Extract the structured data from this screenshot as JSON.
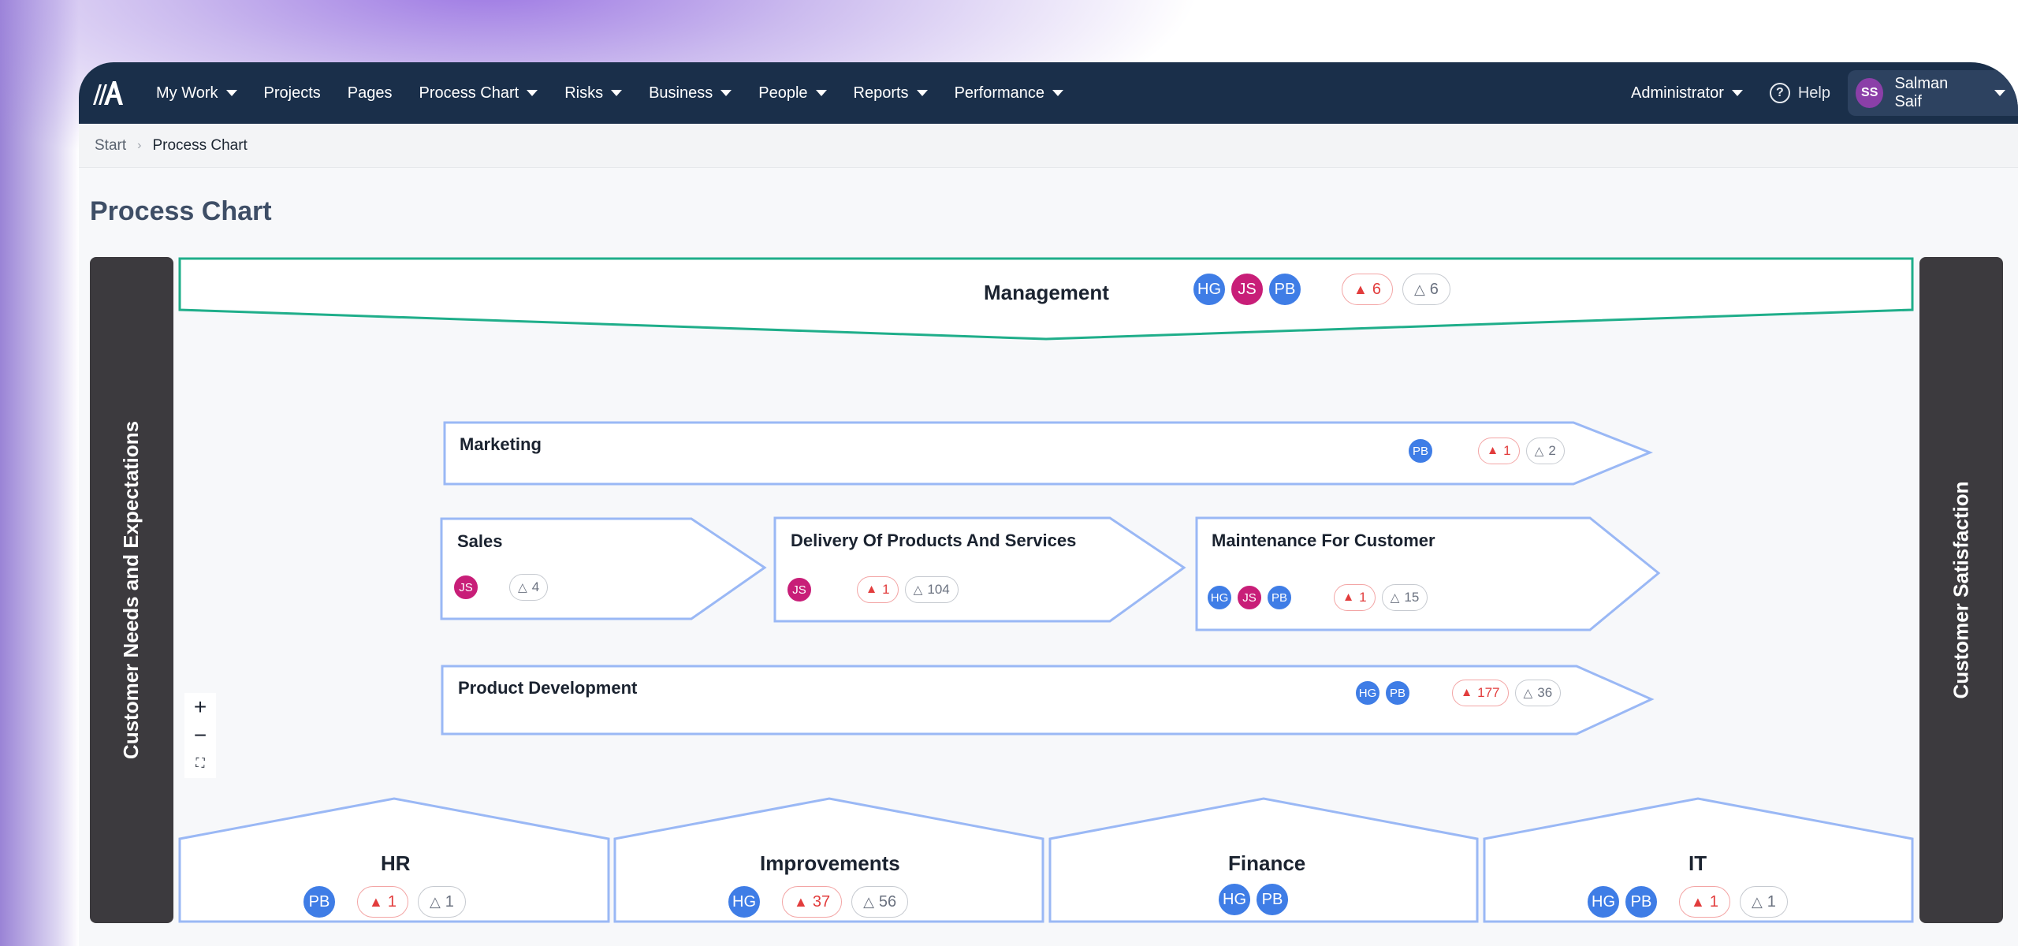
{
  "navbar": {
    "items": [
      {
        "label": "My Work",
        "dropdown": true
      },
      {
        "label": "Projects",
        "dropdown": false
      },
      {
        "label": "Pages",
        "dropdown": false
      },
      {
        "label": "Process Chart",
        "dropdown": true
      },
      {
        "label": "Risks",
        "dropdown": true
      },
      {
        "label": "Business",
        "dropdown": true
      },
      {
        "label": "People",
        "dropdown": true
      },
      {
        "label": "Reports",
        "dropdown": true
      },
      {
        "label": "Performance",
        "dropdown": true
      }
    ],
    "admin_label": "Administrator",
    "help_label": "Help",
    "user": {
      "initials": "SS",
      "name": "Salman Saif"
    }
  },
  "breadcrumb": {
    "start": "Start",
    "current": "Process Chart"
  },
  "page_title": "Process Chart",
  "side_left_label": "Customer Needs and Expectations",
  "side_right_label": "Customer Satisfaction",
  "management": {
    "title": "Management",
    "avatars": [
      "HG",
      "JS",
      "PB"
    ],
    "risks": "6",
    "warnings": "6"
  },
  "marketing": {
    "title": "Marketing",
    "avatars": [
      "PB"
    ],
    "risks": "1",
    "warnings": "2"
  },
  "sales": {
    "title": "Sales",
    "avatars": [
      "JS"
    ],
    "warnings": "4"
  },
  "delivery": {
    "title": "Delivery Of Products And Services",
    "avatars": [
      "JS"
    ],
    "risks": "1",
    "warnings": "104"
  },
  "maintenance": {
    "title": "Maintenance For Customer",
    "avatars": [
      "HG",
      "JS",
      "PB"
    ],
    "risks": "1",
    "warnings": "15"
  },
  "product_dev": {
    "title": "Product Development",
    "avatars": [
      "HG",
      "PB"
    ],
    "risks": "177",
    "warnings": "36"
  },
  "hr": {
    "title": "HR",
    "avatars": [
      "PB"
    ],
    "risks": "1",
    "warnings": "1"
  },
  "improvements": {
    "title": "Improvements",
    "avatars": [
      "HG"
    ],
    "risks": "37",
    "warnings": "56"
  },
  "finance": {
    "title": "Finance",
    "avatars": [
      "HG",
      "PB"
    ]
  },
  "it": {
    "title": "IT",
    "avatars": [
      "HG",
      "PB"
    ],
    "risks": "1",
    "warnings": "1"
  },
  "zoom": {
    "in": "+",
    "out": "−",
    "fit": "⛶"
  },
  "colors": {
    "navbar": "#1a2f4a",
    "management_border": "#1fae8a",
    "process_border": "#9ab8f5",
    "risk": "#e23c3c",
    "avatar_blue": "#3f7de6",
    "avatar_pink": "#c81e78"
  }
}
